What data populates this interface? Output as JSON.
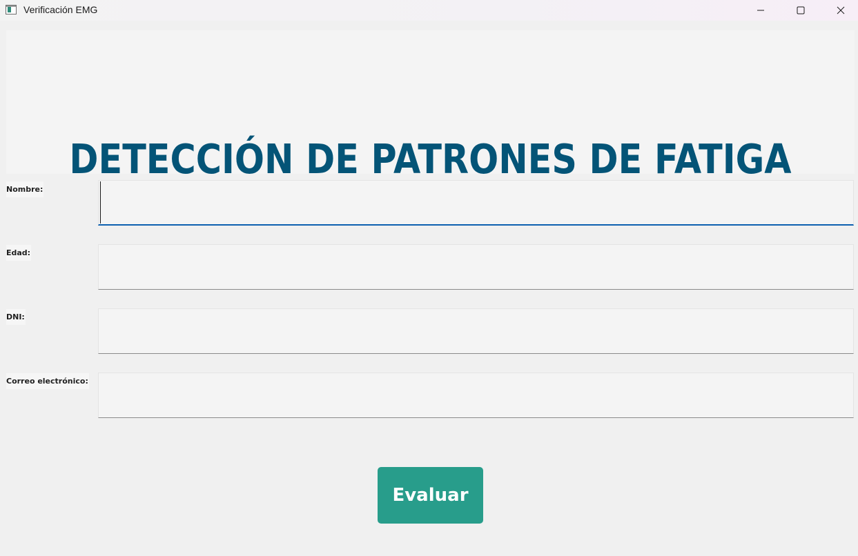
{
  "window": {
    "title": "Verificación EMG",
    "icon": "app-window-icon",
    "controls": [
      "minimize-icon",
      "maximize-icon",
      "close-icon"
    ]
  },
  "header": {
    "title": "DETECCIÓN DE PATRONES DE FATIGA",
    "color": "#045477"
  },
  "form": {
    "fields": [
      {
        "label": "Nombre:",
        "value": "",
        "focused": true
      },
      {
        "label": "Edad:",
        "value": ""
      },
      {
        "label": "DNI:",
        "value": ""
      },
      {
        "label": "Correo electrónico:",
        "value": ""
      }
    ]
  },
  "actions": {
    "evaluate_label": "Evaluar",
    "evaluate_color": "#289d8b"
  },
  "colors": {
    "focus_underline": "#0c5fb0",
    "background": "#f0f0f0"
  }
}
